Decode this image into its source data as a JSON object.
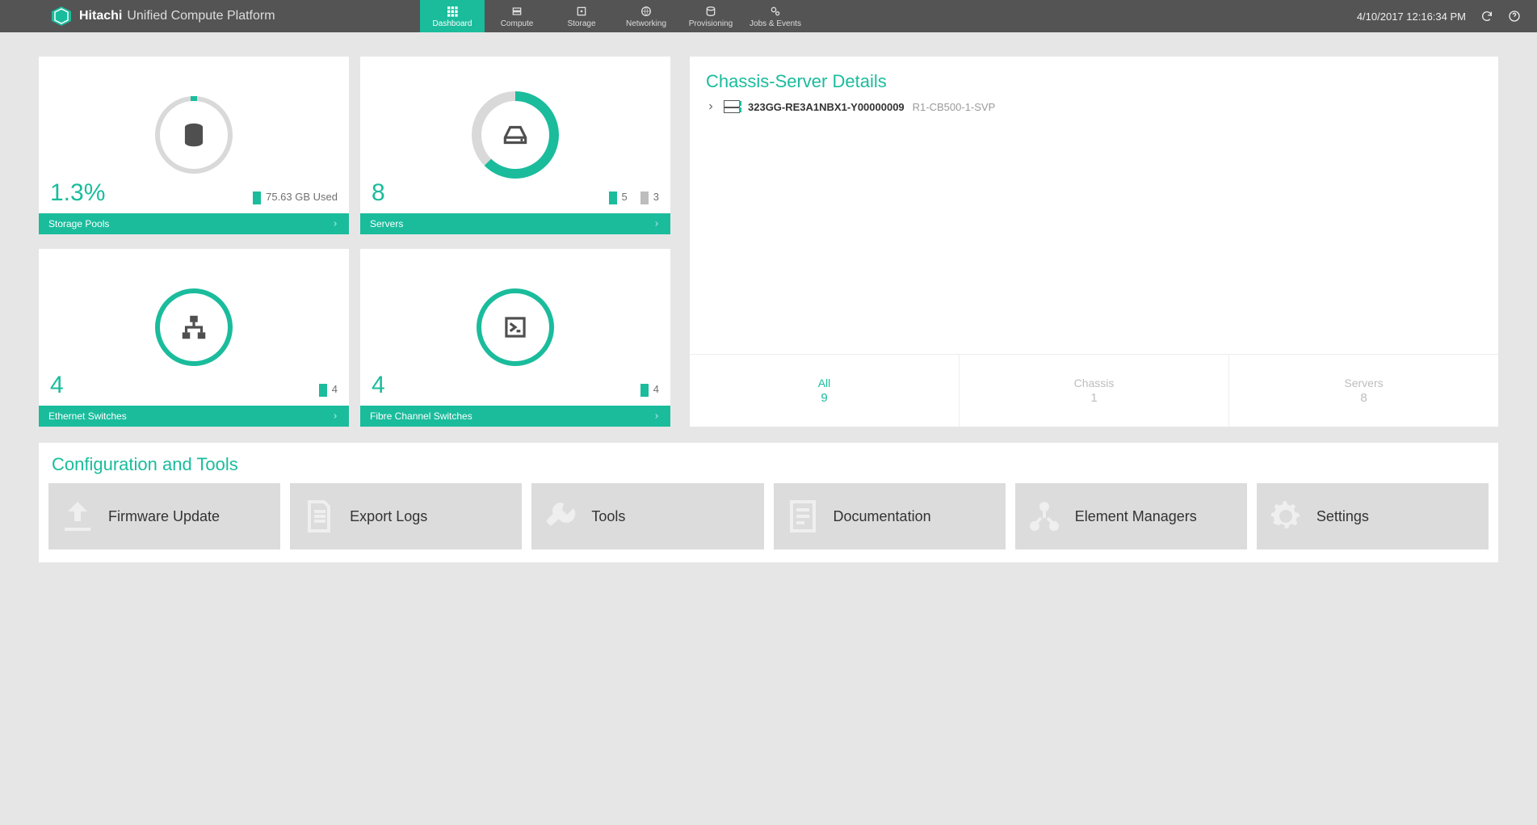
{
  "header": {
    "brand_bold": "Hitachi",
    "brand_rest": "Unified Compute Platform",
    "datetime": "4/10/2017 12:16:34 PM",
    "nav": [
      {
        "label": "Dashboard",
        "active": true
      },
      {
        "label": "Compute",
        "active": false
      },
      {
        "label": "Storage",
        "active": false
      },
      {
        "label": "Networking",
        "active": false
      },
      {
        "label": "Provisioning",
        "active": false
      },
      {
        "label": "Jobs & Events",
        "active": false
      }
    ]
  },
  "cards": {
    "storage": {
      "title": "Storage Pools",
      "pct": "1.3%",
      "used": "75.63 GB Used"
    },
    "servers": {
      "title": "Servers",
      "count": "8",
      "ok": "5",
      "warn": "3"
    },
    "eth": {
      "title": "Ethernet Switches",
      "count": "4",
      "ok": "4"
    },
    "fc": {
      "title": "Fibre Channel Switches",
      "count": "4",
      "ok": "4"
    }
  },
  "chassis": {
    "title": "Chassis-Server Details",
    "item_id": "323GG-RE3A1NBX1-Y00000009",
    "item_sub": "R1-CB500-1-SVP",
    "tabs": [
      {
        "label": "All",
        "count": "9",
        "active": true
      },
      {
        "label": "Chassis",
        "count": "1",
        "active": false
      },
      {
        "label": "Servers",
        "count": "8",
        "active": false
      }
    ]
  },
  "tools": {
    "title": "Configuration and Tools",
    "items": [
      "Firmware Update",
      "Export Logs",
      "Tools",
      "Documentation",
      "Element Managers",
      "Settings"
    ]
  }
}
